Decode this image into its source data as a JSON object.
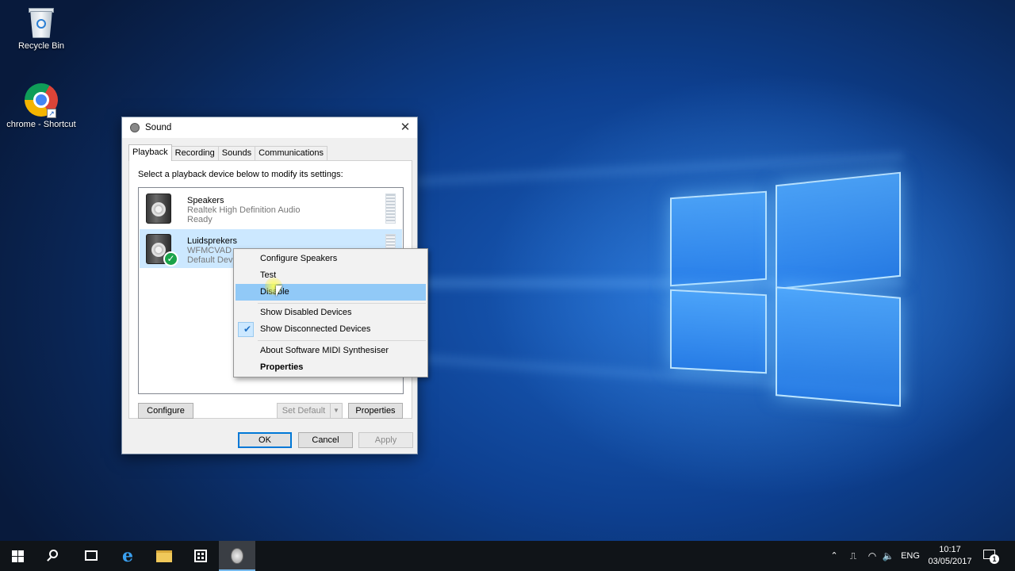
{
  "desktop": {
    "icons": [
      {
        "label": "Recycle Bin",
        "icon": "recycle-bin-icon"
      },
      {
        "label": "chrome - Shortcut",
        "icon": "chrome-icon",
        "shortcut_glyph": "↗"
      }
    ]
  },
  "dialog": {
    "title": "Sound",
    "close_glyph": "✕",
    "tabs": [
      {
        "label": "Playback",
        "active": true
      },
      {
        "label": "Recording",
        "active": false
      },
      {
        "label": "Sounds",
        "active": false
      },
      {
        "label": "Communications",
        "active": false
      }
    ],
    "instruction": "Select a playback device below to modify its settings:",
    "devices": [
      {
        "name": "Speakers",
        "description": "Realtek High Definition Audio",
        "status": "Ready",
        "selected": false,
        "is_default": false
      },
      {
        "name": "Luidsprekers",
        "description": "WFMCVAD",
        "status": "Default Device",
        "selected": true,
        "is_default": true,
        "default_glyph": "✓"
      }
    ],
    "buttons": {
      "configure": "Configure",
      "set_default": "Set Default",
      "set_default_arrow": "▼",
      "properties": "Properties",
      "ok": "OK",
      "cancel": "Cancel",
      "apply": "Apply"
    }
  },
  "context_menu": {
    "items": [
      {
        "label": "Configure Speakers"
      },
      {
        "label": "Test"
      },
      {
        "label": "Disable",
        "highlighted": true
      },
      {
        "label": "Show Disabled Devices"
      },
      {
        "label": "Show Disconnected Devices",
        "checked": true,
        "check_glyph": "✔"
      },
      {
        "label": "About Software MIDI Synthesiser"
      },
      {
        "label": "Properties",
        "bold": true
      }
    ]
  },
  "taskbar": {
    "buttons": [
      "start-icon",
      "search-icon",
      "task-view-icon",
      "edge-icon",
      "file-explorer-icon",
      "store-icon",
      "sound-app-icon"
    ],
    "edge_glyph": "e",
    "tray": {
      "chevron": "⌃",
      "network_glyph": "⎍",
      "wifi_glyph": "◠",
      "volume_glyph": "🔈",
      "language": "ENG",
      "time": "10:17",
      "date": "03/05/2017",
      "notification_count": "1"
    }
  },
  "colors": {
    "selection": "#cce8ff",
    "menu_highlight": "#91c9f7",
    "accent": "#0078d7",
    "taskbar": "#101418"
  }
}
